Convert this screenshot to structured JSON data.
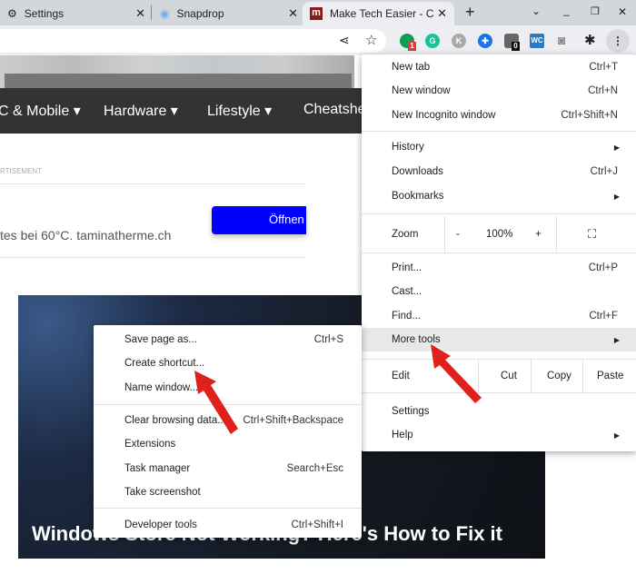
{
  "tabs": [
    {
      "label": "Settings",
      "icon": "gear-icon"
    },
    {
      "label": "Snapdrop",
      "icon": "snapdrop-icon"
    },
    {
      "label": "Make Tech Easier - Co",
      "icon": "mte-logo-icon",
      "active": true
    }
  ],
  "window": {
    "new_tab": "+",
    "dropdown": "⌄",
    "minimize": "_",
    "restore": "❐",
    "close": "✕"
  },
  "extensions": [
    {
      "label": "1",
      "color": "#0f9d58"
    },
    {
      "label": "G",
      "color": "#15c39a"
    },
    {
      "label": "K",
      "color": "#aaaaaa"
    },
    {
      "label": "",
      "color": "#1a73e8"
    },
    {
      "label": "0",
      "color": "#555555"
    },
    {
      "label": "WC",
      "color": "#2b7bbf"
    }
  ],
  "nav": [
    "C & Mobile",
    "Hardware",
    "Lifestyle",
    "Cheatshe"
  ],
  "ad": {
    "label": "RTISEMENT",
    "text": "tes bei 60°C. taminatherme.ch",
    "button": "Öffnen"
  },
  "article": {
    "title": "Windows Store Not Working? Here's How to Fix it"
  },
  "menu": {
    "new_tab": {
      "label": "New tab",
      "shortcut": "Ctrl+T"
    },
    "new_window": {
      "label": "New window",
      "shortcut": "Ctrl+N"
    },
    "incognito": {
      "label": "New Incognito window",
      "shortcut": "Ctrl+Shift+N"
    },
    "history": {
      "label": "History"
    },
    "downloads": {
      "label": "Downloads",
      "shortcut": "Ctrl+J"
    },
    "bookmarks": {
      "label": "Bookmarks"
    },
    "zoom": {
      "label": "Zoom",
      "minus": "-",
      "value": "100%",
      "plus": "+"
    },
    "print": {
      "label": "Print...",
      "shortcut": "Ctrl+P"
    },
    "cast": {
      "label": "Cast..."
    },
    "find": {
      "label": "Find...",
      "shortcut": "Ctrl+F"
    },
    "more_tools": {
      "label": "More tools"
    },
    "edit": {
      "label": "Edit",
      "cut": "Cut",
      "copy": "Copy",
      "paste": "Paste"
    },
    "settings": {
      "label": "Settings"
    },
    "help": {
      "label": "Help"
    }
  },
  "submenu": [
    {
      "label": "Save page as...",
      "shortcut": "Ctrl+S"
    },
    {
      "label": "Create shortcut..."
    },
    {
      "label": "Name window..."
    },
    {
      "label": "Clear browsing data...",
      "shortcut": "Ctrl+Shift+Backspace"
    },
    {
      "label": "Extensions"
    },
    {
      "label": "Task manager",
      "shortcut": "Search+Esc"
    },
    {
      "label": "Take screenshot"
    },
    {
      "label": "Developer tools",
      "shortcut": "Ctrl+Shift+I"
    }
  ],
  "colors": {
    "accent": "#0000ff",
    "arrow": "#e0201b"
  }
}
